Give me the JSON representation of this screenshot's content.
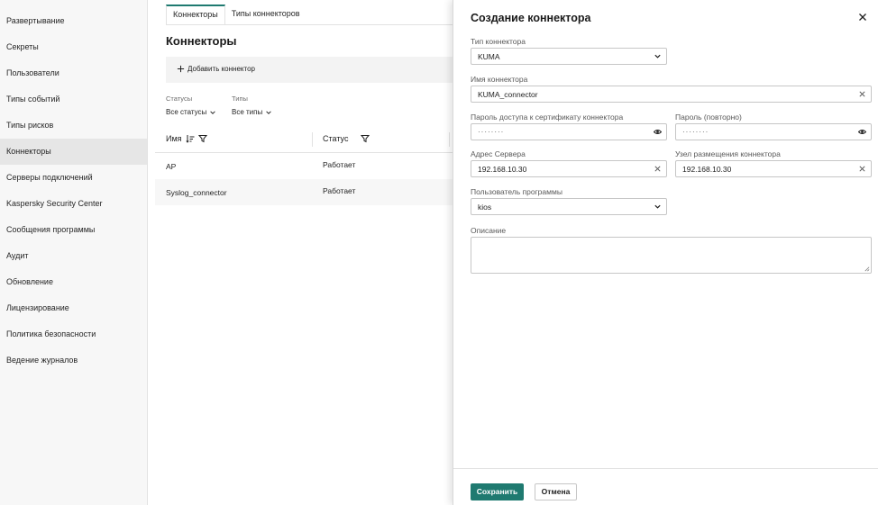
{
  "sidebar": {
    "items": [
      {
        "label": "Развертывание"
      },
      {
        "label": "Секреты"
      },
      {
        "label": "Пользователи"
      },
      {
        "label": "Типы событий"
      },
      {
        "label": "Типы рисков"
      },
      {
        "label": "Коннекторы",
        "active": true
      },
      {
        "label": "Серверы подключений"
      },
      {
        "label": "Kaspersky Security Center"
      },
      {
        "label": "Сообщения программы"
      },
      {
        "label": "Аудит"
      },
      {
        "label": "Обновление"
      },
      {
        "label": "Лицензирование"
      },
      {
        "label": "Политика безопасности"
      },
      {
        "label": "Ведение журналов"
      }
    ]
  },
  "main": {
    "tabs": [
      {
        "label": "Коннекторы",
        "active": true
      },
      {
        "label": "Типы коннекторов"
      }
    ],
    "title": "Коннекторы",
    "add_button": "Добавить коннектор",
    "filters": {
      "statuses_label": "Статусы",
      "statuses_value": "Все статусы",
      "types_label": "Типы",
      "types_value": "Все типы"
    },
    "table": {
      "columns": {
        "name": "Имя",
        "status": "Статус"
      },
      "rows": [
        {
          "name": "AP",
          "status": "Работает"
        },
        {
          "name": "Syslog_connector",
          "status": "Работает"
        }
      ]
    }
  },
  "panel": {
    "title": "Создание коннектора",
    "connector_type": {
      "label": "Тип коннектора",
      "value": "KUMA"
    },
    "connector_name": {
      "label": "Имя коннектора",
      "value": "KUMA_connector"
    },
    "cert_password": {
      "label": "Пароль доступа к сертификату коннектора",
      "value": "········"
    },
    "password_repeat": {
      "label": "Пароль (повторно)",
      "value": "········"
    },
    "server_address": {
      "label": "Адрес Сервера",
      "value": "192.168.10.30"
    },
    "host_node": {
      "label": "Узел размещения коннектора",
      "value": "192.168.10.30"
    },
    "app_user": {
      "label": "Пользователь программы",
      "value": "kios"
    },
    "description": {
      "label": "Описание",
      "value": ""
    },
    "save_label": "Сохранить",
    "cancel_label": "Отмена"
  },
  "colors": {
    "accent": "#1f7a70"
  }
}
